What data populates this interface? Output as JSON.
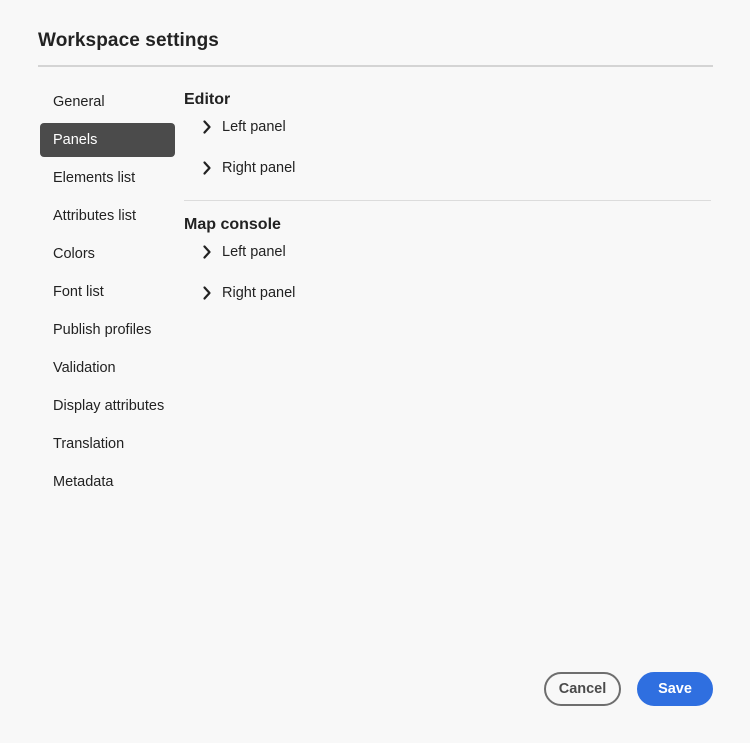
{
  "dialog": {
    "title": "Workspace settings"
  },
  "sidebar": {
    "items": [
      {
        "label": "General",
        "selected": false
      },
      {
        "label": "Panels",
        "selected": true
      },
      {
        "label": "Elements list",
        "selected": false
      },
      {
        "label": "Attributes list",
        "selected": false
      },
      {
        "label": "Colors",
        "selected": false
      },
      {
        "label": "Font list",
        "selected": false
      },
      {
        "label": "Publish profiles",
        "selected": false
      },
      {
        "label": "Validation",
        "selected": false
      },
      {
        "label": "Display attributes",
        "selected": false
      },
      {
        "label": "Translation",
        "selected": false
      },
      {
        "label": "Metadata",
        "selected": false
      }
    ]
  },
  "sections": [
    {
      "title": "Editor",
      "rows": [
        {
          "label": "Left panel",
          "icon": "chevron-right-icon"
        },
        {
          "label": "Right panel",
          "icon": "chevron-right-icon"
        }
      ]
    },
    {
      "title": "Map console",
      "rows": [
        {
          "label": "Left panel",
          "icon": "chevron-right-icon"
        },
        {
          "label": "Right panel",
          "icon": "chevron-right-icon"
        }
      ]
    }
  ],
  "footer": {
    "cancel_label": "Cancel",
    "save_label": "Save"
  },
  "colors": {
    "background": "#f8f8f8",
    "selected_item_bg": "#4b4b4b",
    "primary_button": "#2f6fe0"
  }
}
